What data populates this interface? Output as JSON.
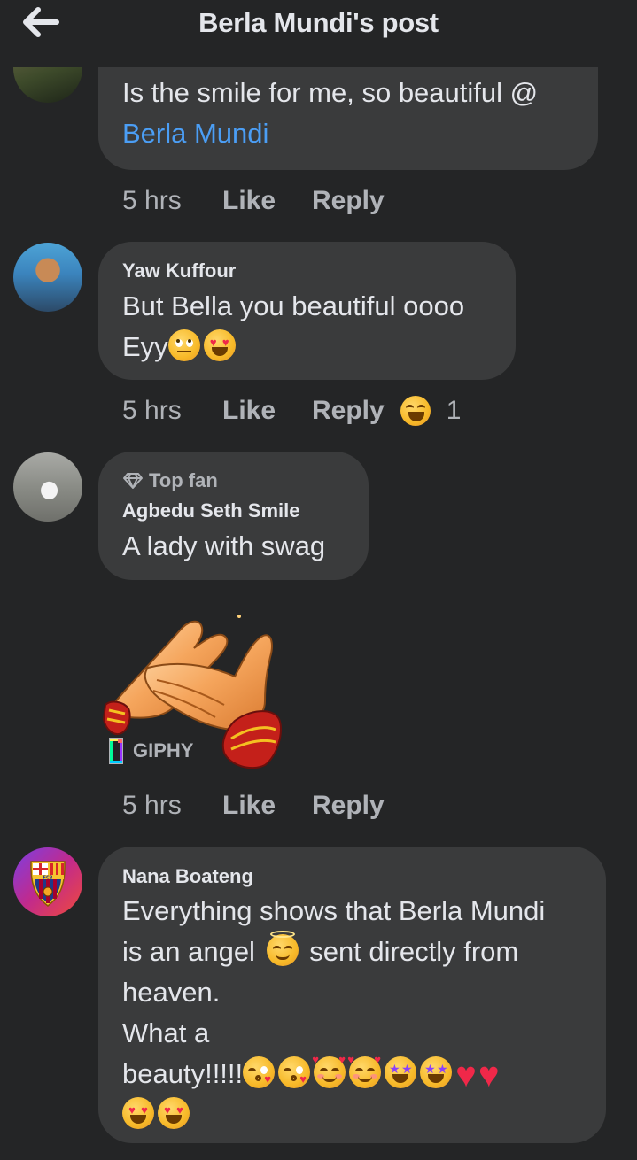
{
  "header": {
    "title": "Berla Mundi's post",
    "back_icon": "arrow-left-icon"
  },
  "comments": [
    {
      "author": "",
      "text_line1": "Is the smile for me, so beautiful @",
      "mention": "Berla Mundi",
      "time": "5 hrs",
      "like": "Like",
      "reply": "Reply"
    },
    {
      "author": "Yaw Kuffour",
      "text_line1": "But Bella you beautiful oooo",
      "text_line2": "Eyy",
      "line2_emojis": [
        "face-with-rolling-eyes",
        "smiling-face-with-heart-eyes"
      ],
      "time": "5 hrs",
      "like": "Like",
      "reply": "Reply",
      "reaction_icon": "laughing-face-emoji",
      "reaction_count": "1"
    },
    {
      "badge": "Top fan",
      "badge_icon": "diamond-icon",
      "author": "Agbedu Seth Smile",
      "text": "A lady with swag",
      "gif_source": "GIPHY",
      "gif_icon": "clapping-hands-gif",
      "time": "5 hrs",
      "like": "Like",
      "reply": "Reply"
    },
    {
      "author": "Nana Boateng",
      "line1": "Everything shows that Berla Mundi",
      "line2a": "is an angel",
      "line2b": "sent directly from",
      "line3": "heaven.",
      "line4": "What a",
      "line5": "beauty!!!!!",
      "line2_emoji": "smiling-face-with-halo",
      "line5_emojis": [
        "face-blowing-a-kiss",
        "face-blowing-a-kiss",
        "smiling-face-with-hearts",
        "smiling-face-with-hearts",
        "star-struck",
        "star-struck",
        "red-heart",
        "red-heart"
      ],
      "line6_emojis": [
        "smiling-face-with-heart-eyes",
        "smiling-face-with-heart-eyes"
      ]
    }
  ],
  "colors": {
    "background": "#242526",
    "bubble": "#3a3b3c",
    "text": "#e4e6eb",
    "secondary_text": "#b0b3b8",
    "mention": "#4b9ef5"
  }
}
